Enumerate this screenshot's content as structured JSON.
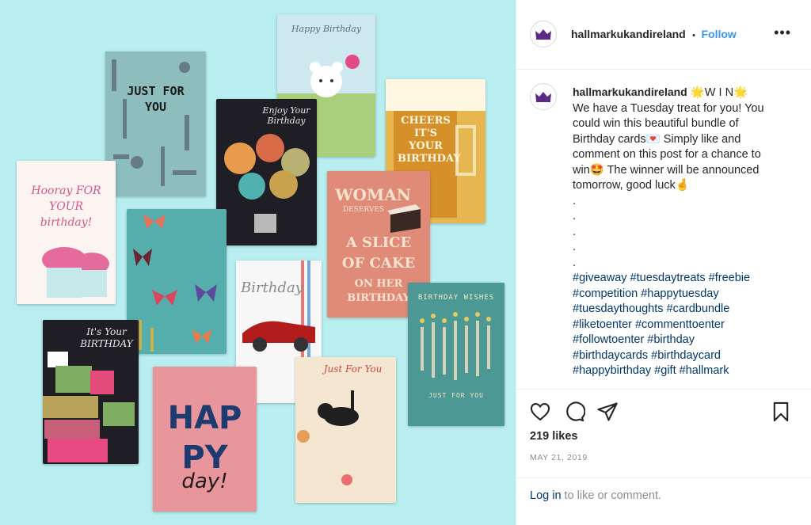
{
  "post": {
    "username": "hallmarkukandireland",
    "follow_separator": "•",
    "follow_label": "Follow",
    "more_label": "•••"
  },
  "caption": {
    "username": "hallmarkukandireland",
    "lines": [
      "🌟W I N🌟",
      "We have a Tuesday treat for you! You",
      "could win this beautiful bundle of",
      "Birthday cards💌 Simply like and",
      "comment on this post for a chance to",
      "win🤩 The winner will be announced",
      "tomorrow, good luck🤞"
    ],
    "dots": [
      ".",
      ".",
      ".",
      ".",
      "."
    ],
    "hashtags": [
      "#giveaway #tuesdaytreats #freebie",
      "#competition #happytuesday",
      "#tuesdaythoughts #cardbundle",
      "#liketoenter #commenttoenter",
      "#followtoenter #birthday",
      "#birthdaycards #birthdaycard",
      "#happybirthday #gift #hallmark"
    ]
  },
  "stats": {
    "likes": "219 likes",
    "date": "MAY 21, 2019"
  },
  "login": {
    "link": "Log in",
    "rest": " to like or comment."
  },
  "cards": {
    "just_for_you": "JUST FOR YOU",
    "happy_birthday_top": "Happy Birthday",
    "enjoy_your_birthday": "Enjoy Your Birthday",
    "cheers_its_your_birthday": "CHEERS IT'S YOUR BIRTHDAY",
    "hooray": "Hooray FOR YOUR birthday!",
    "woman": "WOMAN",
    "deserves": "DESERVES",
    "slice_of_cake": "A SLICE OF CAKE",
    "on_her_birthday": "ON HER BIRTHDAY",
    "its_your_birthday": "It's Your BIRTHDAY",
    "birthday_script": "Birthday",
    "birthday_wishes": "BIRTHDAY WISHES",
    "just_for_you_small": "JUST FOR YOU",
    "happy": "HAPPY",
    "day": "day!",
    "just_for_you_script": "Just For You"
  },
  "colors": {
    "background": "#b8eef0",
    "link": "#00376b",
    "follow": "#3897f0"
  },
  "icons": [
    "hallmark-crown-icon",
    "heart-icon",
    "comment-icon",
    "share-icon",
    "bookmark-icon",
    "more-options-icon"
  ]
}
